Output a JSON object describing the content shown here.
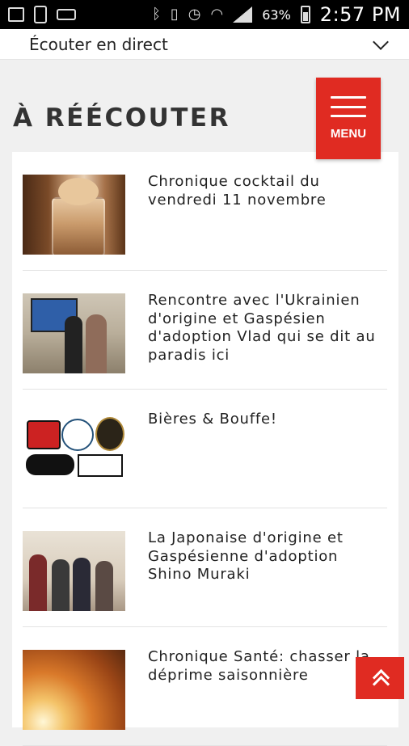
{
  "status_bar": {
    "battery_percent": "63%",
    "time": "2:57 PM",
    "icons": [
      "image-icon",
      "phone-icon",
      "voicemail-icon",
      "bluetooth-icon",
      "vibrate-icon",
      "alarm-icon",
      "wifi-icon",
      "signal-icon",
      "battery-icon"
    ]
  },
  "listen_bar": {
    "label": "Écouter en direct"
  },
  "section": {
    "title": "À RÉÉCOUTER"
  },
  "menu": {
    "label": "MENU"
  },
  "items": [
    {
      "title": "Chronique cocktail du vendredi 11 novembre"
    },
    {
      "title": "Rencontre avec l'Ukrainien d'origine et Gaspésien d'adoption Vlad qui se dit au paradis ici"
    },
    {
      "title": "Bières & Bouffe!"
    },
    {
      "title": "La Japonaise d'origine et Gaspésienne d'adoption Shino Muraki"
    },
    {
      "title": "Chronique Santé: chasser la déprime saisonnière"
    }
  ],
  "colors": {
    "accent": "#e02b22",
    "background": "#f0f0f0"
  }
}
